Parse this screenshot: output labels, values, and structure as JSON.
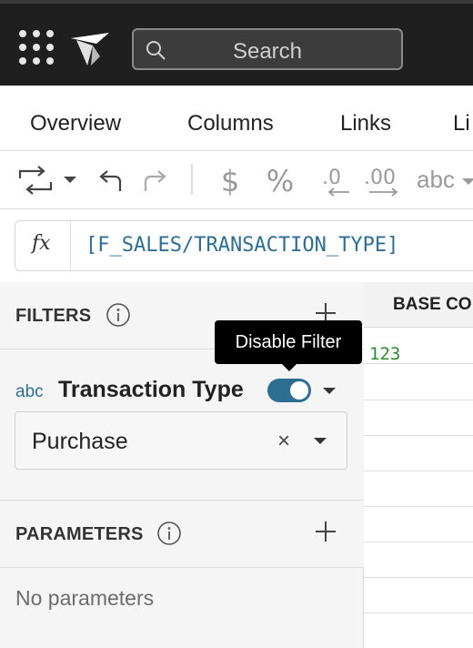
{
  "topbar": {
    "search_placeholder": "Search",
    "icons": [
      "app-grid-icon",
      "logo-icon",
      "search-icon"
    ]
  },
  "tabs": [
    {
      "label": "Overview"
    },
    {
      "label": "Columns"
    },
    {
      "label": "Links"
    },
    {
      "label": "Li"
    }
  ],
  "toolbar": {
    "icons": [
      "convert-icon",
      "undo-icon",
      "redo-icon",
      "currency-icon",
      "percent-icon",
      "decrease-decimal-icon",
      "increase-decimal-icon"
    ],
    "format_label": "abc"
  },
  "formula": {
    "fx_label": "fx",
    "expression": "[F_SALES/TRANSACTION_TYPE]"
  },
  "filters": {
    "title": "FILTERS",
    "item": {
      "type_label": "abc",
      "name": "Transaction Type",
      "enabled": true,
      "selected_value": "Purchase"
    },
    "tooltip": "Disable Filter"
  },
  "parameters": {
    "title": "PARAMETERS",
    "empty_text": "No parameters"
  },
  "grid": {
    "header": "BASE CO",
    "first_value": "123"
  },
  "colors": {
    "topbar": "#1f1f1f",
    "accent": "#2f6e93",
    "number_green": "#2f8a2f"
  }
}
